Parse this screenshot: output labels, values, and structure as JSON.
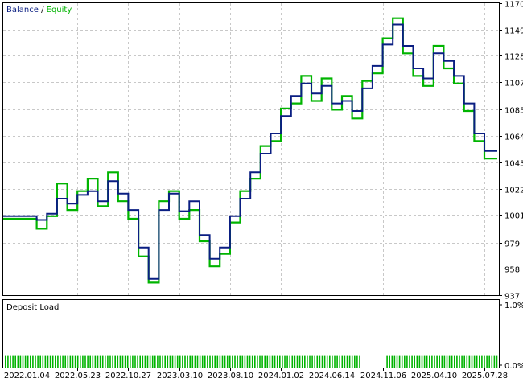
{
  "legend": {
    "balance_label": "Balance",
    "separator": " / ",
    "equity_label": "Equity"
  },
  "lower_panel": {
    "title": "Deposit Load",
    "y_ticks": [
      "1.0%",
      "0.0%"
    ],
    "ylim": [
      0,
      1
    ],
    "bar_color": "#00b400",
    "bar_level": 0.2
  },
  "colors": {
    "balance": "#0a1e82",
    "equity": "#00b400"
  },
  "chart_data": {
    "type": "line",
    "title": "",
    "ylim": [
      937,
      1170
    ],
    "y_ticks": [
      1170,
      1149,
      1128,
      1107,
      1085,
      1064,
      1043,
      1022,
      1001,
      979,
      958,
      937
    ],
    "x_ticks": [
      "2022.01.04",
      "2022.05.23",
      "2022.10.27",
      "2023.03.10",
      "2023.08.10",
      "2024.01.02",
      "2024.06.14",
      "2024.11.06",
      "2025.04.10",
      "2025.07.28"
    ],
    "grid": true,
    "legend_position": "top-left",
    "series": [
      {
        "name": "Balance",
        "x_tick_pos": [
          0,
          0.2,
          0.4,
          0.6,
          0.8,
          1.0,
          1.2,
          1.4,
          1.6,
          1.8,
          2.0,
          2.2,
          2.4,
          2.6,
          2.8,
          3.0,
          3.2,
          3.4,
          3.6,
          3.8,
          4.0,
          4.2,
          4.4,
          4.6,
          4.8,
          5.0,
          5.2,
          5.4,
          5.6,
          5.8,
          6.0,
          6.2,
          6.4,
          6.6,
          6.8,
          7.0,
          7.2,
          7.4,
          7.6,
          7.8,
          8.0,
          8.2,
          8.4,
          8.6,
          8.8,
          9.0
        ],
        "values": [
          1000,
          997,
          1002,
          1014,
          1010,
          1017,
          1020,
          1012,
          1028,
          1018,
          1005,
          975,
          950,
          1005,
          1018,
          1004,
          1012,
          985,
          966,
          975,
          1000,
          1014,
          1035,
          1050,
          1066,
          1080,
          1096,
          1106,
          1098,
          1104,
          1090,
          1092,
          1084,
          1102,
          1120,
          1137,
          1153,
          1136,
          1118,
          1110,
          1130,
          1124,
          1112,
          1090,
          1066,
          1052
        ]
      },
      {
        "name": "Equity",
        "x_tick_pos": [
          0,
          0.2,
          0.4,
          0.6,
          0.8,
          1.0,
          1.2,
          1.4,
          1.6,
          1.8,
          2.0,
          2.2,
          2.4,
          2.6,
          2.8,
          3.0,
          3.2,
          3.4,
          3.6,
          3.8,
          4.0,
          4.2,
          4.4,
          4.6,
          4.8,
          5.0,
          5.2,
          5.4,
          5.6,
          5.8,
          6.0,
          6.2,
          6.4,
          6.6,
          6.8,
          7.0,
          7.2,
          7.4,
          7.6,
          7.8,
          8.0,
          8.2,
          8.4,
          8.6,
          8.8,
          9.0
        ],
        "values": [
          998,
          990,
          1000,
          1026,
          1005,
          1020,
          1030,
          1008,
          1035,
          1012,
          998,
          968,
          947,
          1012,
          1020,
          998,
          1005,
          980,
          960,
          970,
          995,
          1020,
          1030,
          1056,
          1060,
          1086,
          1090,
          1112,
          1092,
          1110,
          1085,
          1096,
          1078,
          1108,
          1114,
          1142,
          1158,
          1130,
          1112,
          1104,
          1136,
          1118,
          1106,
          1084,
          1060,
          1046
        ]
      }
    ]
  }
}
